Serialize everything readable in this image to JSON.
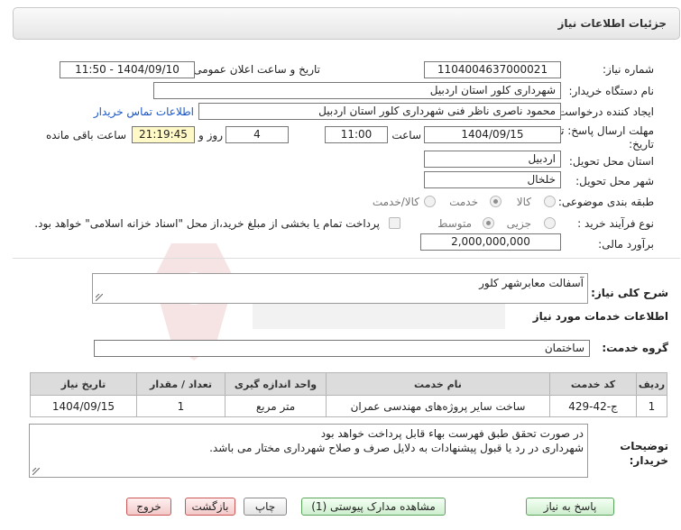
{
  "header": {
    "title": "جزئیات اطلاعات نیاز"
  },
  "form": {
    "need_number": {
      "label": "شماره نیاز:",
      "value": "1104004637000021"
    },
    "announce_datetime": {
      "label": "تاریخ و ساعت اعلان عمومی:",
      "value": "1404/09/10 - 11:50"
    },
    "buyer_org": {
      "label": "نام دستگاه خریدار:",
      "value": "شهرداری کلور استان اردبیل"
    },
    "requester": {
      "label": "ایجاد کننده درخواست:",
      "value": "محمود  ناصری  ناظر فنی  شهرداری کلور استان اردبیل",
      "contact_link": "اطلاعات تماس خریدار"
    },
    "deadline": {
      "label": "مهلت ارسال پاسخ: تا تاریخ:",
      "date": "1404/09/15",
      "time_label": "ساعت",
      "time": "11:00",
      "days": "4",
      "days_label": "روز و",
      "remaining": "21:19:45",
      "remaining_label": "ساعت باقی مانده"
    },
    "province": {
      "label": "استان محل تحویل:",
      "value": "اردبیل"
    },
    "city": {
      "label": "شهر محل تحویل:",
      "value": "خلخال"
    },
    "category": {
      "label": "طبقه بندی موضوعی:",
      "options": [
        "کالا",
        "خدمت",
        "کالا/خدمت"
      ],
      "selected": "خدمت"
    },
    "process": {
      "label": "نوع فرآیند خرید :",
      "options": [
        "جزیی",
        "متوسط"
      ],
      "selected": "متوسط",
      "payment_note": "پرداخت تمام یا بخشی از مبلغ خرید،از محل \"اسناد خزانه اسلامی\" خواهد بود."
    },
    "budget": {
      "label": "برآورد مالی:",
      "value": "2,000,000,000"
    }
  },
  "summary": {
    "label": "شرح کلی نیاز:",
    "value": "آسفالت معابرشهر کلور"
  },
  "services": {
    "title": "اطلاعات خدمات مورد نیاز",
    "group_label": "گروه خدمت:",
    "group_value": "ساختمان",
    "columns": [
      "ردیف",
      "کد خدمت",
      "نام خدمت",
      "واحد اندازه گیری",
      "تعداد / مقدار",
      "تاریخ نیاز"
    ],
    "rows": [
      {
        "row": "1",
        "code": "ج-42-429",
        "name": "ساخت سایر پروژه‌های مهندسی عمران",
        "unit": "متر مربع",
        "qty": "1",
        "date": "1404/09/15"
      }
    ]
  },
  "notes": {
    "label_line1": "توضیحات",
    "label_line2": "خریدار:",
    "line1": "در صورت تحقق طبق فهرست بهاء قابل پرداخت خواهد بود",
    "line2": "شهرداری در رد یا قبول پیشنهادات به دلایل  صرف و صلاح شهرداری مختار می باشد."
  },
  "buttons": {
    "reply": "پاسخ به نیاز",
    "attachments": "مشاهده مدارک پیوستی (1)",
    "print": "چاپ",
    "back": "بازگشت",
    "exit": "خروج"
  },
  "colors": {
    "link": "#1a56c4",
    "highlight": "#fff9c8",
    "header_bg": "#e6e6e6"
  }
}
